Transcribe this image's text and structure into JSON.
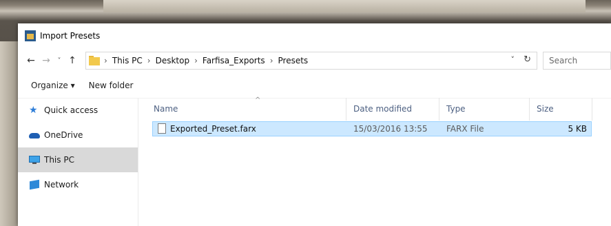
{
  "window": {
    "title": "Import Presets"
  },
  "nav": {
    "back": "←",
    "forward": "→",
    "recent": "˅",
    "up": "↑"
  },
  "address": {
    "breadcrumbs": [
      "This PC",
      "Desktop",
      "Farfisa_Exports",
      "Presets"
    ],
    "separator": "›",
    "dropdown": "˅",
    "refresh": "↻"
  },
  "search": {
    "placeholder": "Search"
  },
  "toolbar": {
    "organize_label": "Organize ▾",
    "new_folder_label": "New folder"
  },
  "sidebar": {
    "items": [
      {
        "label": "Quick access",
        "icon": "star-icon"
      },
      {
        "label": "OneDrive",
        "icon": "cloud-icon"
      },
      {
        "label": "This PC",
        "icon": "computer-icon",
        "selected": true
      },
      {
        "label": "Network",
        "icon": "network-icon"
      }
    ]
  },
  "columns": {
    "name": "Name",
    "date": "Date modified",
    "type": "Type",
    "size": "Size",
    "sort_indicator": "^"
  },
  "files": [
    {
      "name": "Exported_Preset.farx",
      "date": "15/03/2016 13:55",
      "type": "FARX File",
      "size": "5 KB"
    }
  ],
  "colors": {
    "selection": "#cce8ff",
    "selection_border": "#99d1ff",
    "sidebar_selected": "#d9d9d9"
  }
}
